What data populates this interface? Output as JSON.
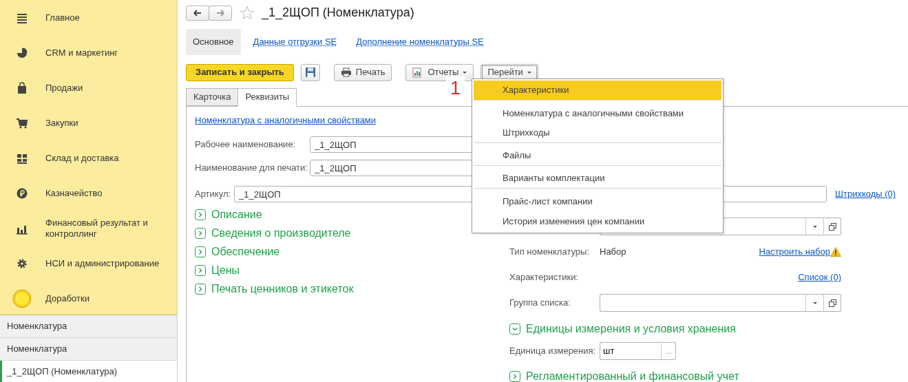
{
  "sidebar": {
    "sections": [
      {
        "label": "Главное"
      },
      {
        "label": "CRM и маркетинг"
      },
      {
        "label": "Продажи"
      },
      {
        "label": "Закупки"
      },
      {
        "label": "Склад и доставка"
      },
      {
        "label": "Казначейство"
      },
      {
        "label": "Финансовый результат и контроллинг"
      },
      {
        "label": "НСИ и администрирование"
      },
      {
        "label": "Доработки"
      }
    ],
    "open_windows": [
      {
        "label": "Номенклатура",
        "selected": false
      },
      {
        "label": "Номенклатура",
        "selected": false
      },
      {
        "label": "_1_2ЩОП (Номенклатура)",
        "selected": true
      }
    ]
  },
  "window": {
    "title": "_1_2ЩОП (Номенклатура)",
    "favorite": false
  },
  "panel_tabs": [
    {
      "label": "Основное",
      "selected": true
    },
    {
      "label": "Данные отгрузки SE",
      "selected": false
    },
    {
      "label": "Дополнение номенклатуры SE",
      "selected": false
    }
  ],
  "toolbar": [
    {
      "kind": "primary",
      "label": "Записать и закрыть"
    },
    {
      "kind": "save"
    },
    {
      "kind": "print",
      "label": "Печать"
    },
    {
      "kind": "reports",
      "label": "Отчеты"
    },
    {
      "kind": "goto",
      "label": "Перейти"
    }
  ],
  "annotation": "1",
  "goto_menu": [
    {
      "label": "Характеристики",
      "selected": true,
      "separator_after": true
    },
    {
      "label": "Номенклатура с аналогичными свойствами",
      "selected": false,
      "separator_after": false
    },
    {
      "label": "Штрихкоды",
      "selected": false,
      "separator_after": true
    },
    {
      "label": "Файлы",
      "selected": false,
      "separator_after": true
    },
    {
      "label": "Варианты комплектации",
      "selected": false,
      "separator_after": true
    },
    {
      "label": "Прайс-лист компании",
      "selected": false,
      "separator_after": false
    },
    {
      "label": "История изменения цен компании",
      "selected": false,
      "separator_after": false
    }
  ],
  "form_tabs": [
    {
      "label": "Карточка",
      "selected": false
    },
    {
      "label": "Реквизиты",
      "selected": true
    }
  ],
  "similar_link": "Номенклатура с аналогичными свойствами",
  "name_fields": [
    {
      "label": "Рабочее наименование:",
      "value": "_1_2ЩОП"
    },
    {
      "label": "Наименование для печати:",
      "value": "_1_2ЩОП"
    }
  ],
  "article": {
    "label": "Артикул:",
    "value": "_1_2ЩОП",
    "link": "Штрихкоды (0)"
  },
  "sections_left": [
    {
      "label": "Описание",
      "expanded": false
    },
    {
      "label": "Сведения о производителе",
      "expanded": false
    },
    {
      "label": "Обеспечение",
      "expanded": false
    },
    {
      "label": "Цены",
      "expanded": false
    },
    {
      "label": "Печать ценников и этикеток",
      "expanded": false
    }
  ],
  "right_rows": [
    {
      "kind": "combo"
    },
    {
      "kind": "text",
      "label": "Тип номенклатуры:",
      "value": "Набор",
      "link": "Настроить набор",
      "warning": true
    },
    {
      "kind": "link",
      "label": "Характеристики:",
      "link": "Список (0)"
    },
    {
      "kind": "combo",
      "label": "Группа списка:"
    }
  ],
  "units_section": {
    "label": "Единицы измерения и условия хранения",
    "expanded": true
  },
  "unit": {
    "label": "Единица измерения:",
    "value": "шт",
    "button": "..."
  },
  "accounting_section": {
    "label": "Регламентированный и финансовый учет",
    "expanded": false
  }
}
